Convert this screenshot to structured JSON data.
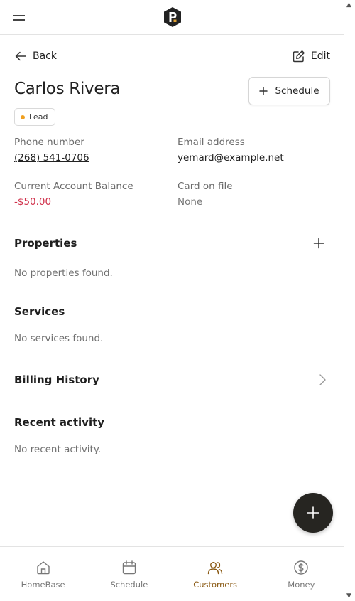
{
  "customer": {
    "name": "Carlos Rivera",
    "status": "Lead",
    "phone_label": "Phone number",
    "phone": "(268) 541-0706",
    "email_label": "Email address",
    "email": "yemard@example.net",
    "balance_label": "Current Account Balance",
    "balance": "-$50.00",
    "card_label": "Card on file",
    "card": "None"
  },
  "nav": {
    "back_label": "Back",
    "edit_label": "Edit"
  },
  "actions": {
    "schedule_label": "Schedule"
  },
  "sections": {
    "properties": {
      "title": "Properties",
      "empty": "No properties found."
    },
    "services": {
      "title": "Services",
      "empty": "No services found."
    },
    "billing": {
      "title": "Billing History"
    },
    "activity": {
      "title": "Recent activity",
      "empty": "No recent activity."
    }
  },
  "bottom_nav": {
    "tabs": [
      {
        "label": "HomeBase",
        "icon": "home-icon"
      },
      {
        "label": "Schedule",
        "icon": "calendar-icon"
      },
      {
        "label": "Customers",
        "icon": "users-icon"
      },
      {
        "label": "Money",
        "icon": "dollar-icon"
      }
    ],
    "active": "Customers"
  },
  "colors": {
    "accent": "#8a5a14",
    "negative": "#d0304a",
    "lead_dot": "#f0a020",
    "fab": "#262521"
  }
}
